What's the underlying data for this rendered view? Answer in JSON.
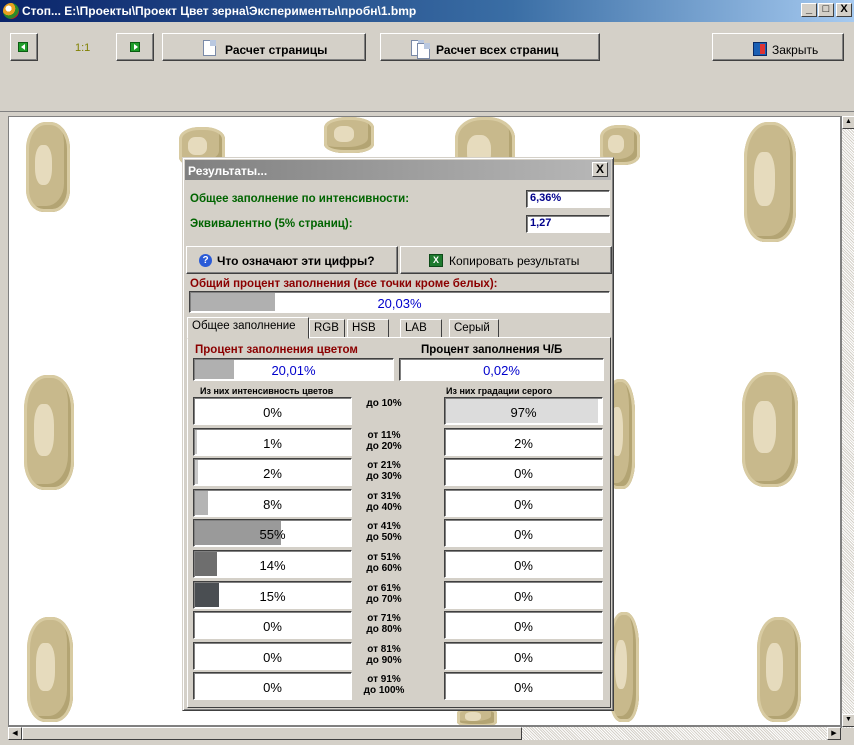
{
  "window": {
    "title": "Стоп... E:\\Проекты\\Проект Цвет зерна\\Эксперименты\\пробн\\1.bmp",
    "min": "_",
    "max": "□",
    "close": "X"
  },
  "toolbar": {
    "scale": "1:1",
    "calc_page": "Расчет страницы",
    "calc_all": "Расчет всех страниц",
    "close": "Закрыть"
  },
  "dialog": {
    "title": "Результаты...",
    "close": "X",
    "fill_intensity_label": "Общее заполнение по интенсивности:",
    "fill_intensity_value": "6,36%",
    "equivalent_label": "Эквивалентно (5% страниц):",
    "equivalent_value": "1,27",
    "help_button": "Что означают эти цифры?",
    "copy_button": "Копировать результаты",
    "total_title": "Общий процент заполнения (все точки кроме белых):",
    "total_value": "20,03%",
    "total_fraction": 0.2003,
    "tabs": [
      "Общее заполнение",
      "RGB",
      "HSB",
      "LAB",
      "Серый"
    ],
    "color_title": "Процент заполнения цветом",
    "color_value": "20,01%",
    "color_fraction": 0.2001,
    "bw_title": "Процент заполнения Ч/Б",
    "bw_value": "0,02%",
    "bw_fraction": 0.0002,
    "intensity_header": "Из них интенсивность цветов",
    "gray_header": "Из них градации серого",
    "rows": [
      {
        "color": "0%",
        "color_fraction": 0.0,
        "range1": "до 10%",
        "range2": "",
        "gray": "97%",
        "gray_fraction": 0.97
      },
      {
        "color": "1%",
        "color_fraction": 0.01,
        "range1": "от 11%",
        "range2": "до 20%",
        "gray": "2%",
        "gray_fraction": 0.0
      },
      {
        "color": "2%",
        "color_fraction": 0.02,
        "range1": "от 21%",
        "range2": "до 30%",
        "gray": "0%",
        "gray_fraction": 0.0
      },
      {
        "color": "8%",
        "color_fraction": 0.08,
        "range1": "от 31%",
        "range2": "до 40%",
        "gray": "0%",
        "gray_fraction": 0.0
      },
      {
        "color": "55%",
        "color_fraction": 0.55,
        "range1": "от 41%",
        "range2": "до 50%",
        "gray": "0%",
        "gray_fraction": 0.0
      },
      {
        "color": "14%",
        "color_fraction": 0.14,
        "range1": "от 51%",
        "range2": "до 60%",
        "gray": "0%",
        "gray_fraction": 0.0
      },
      {
        "color": "15%",
        "color_fraction": 0.15,
        "range1": "от 61%",
        "range2": "до 70%",
        "gray": "0%",
        "gray_fraction": 0.0
      },
      {
        "color": "0%",
        "color_fraction": 0.0,
        "range1": "от 71%",
        "range2": "до 80%",
        "gray": "0%",
        "gray_fraction": 0.0
      },
      {
        "color": "0%",
        "color_fraction": 0.0,
        "range1": "от 81%",
        "range2": "до 90%",
        "gray": "0%",
        "gray_fraction": 0.0
      },
      {
        "color": "0%",
        "color_fraction": 0.0,
        "range1": "от 91%",
        "range2": "до 100%",
        "gray": "0%",
        "gray_fraction": 0.0
      }
    ],
    "fill_colors": [
      "#c8c8c8",
      "#c8c8c8",
      "#c8c8c8",
      "#b4b4b4",
      "#9a9a9a",
      "#6e6e6e",
      "#4a4e52",
      "#303030",
      "#202020",
      "#101010"
    ],
    "gray_fill_color": "#dcdcdc"
  },
  "colors": {
    "label_green": "#006400",
    "section_red": "#8b0000",
    "value_blue": "#0000cc"
  }
}
